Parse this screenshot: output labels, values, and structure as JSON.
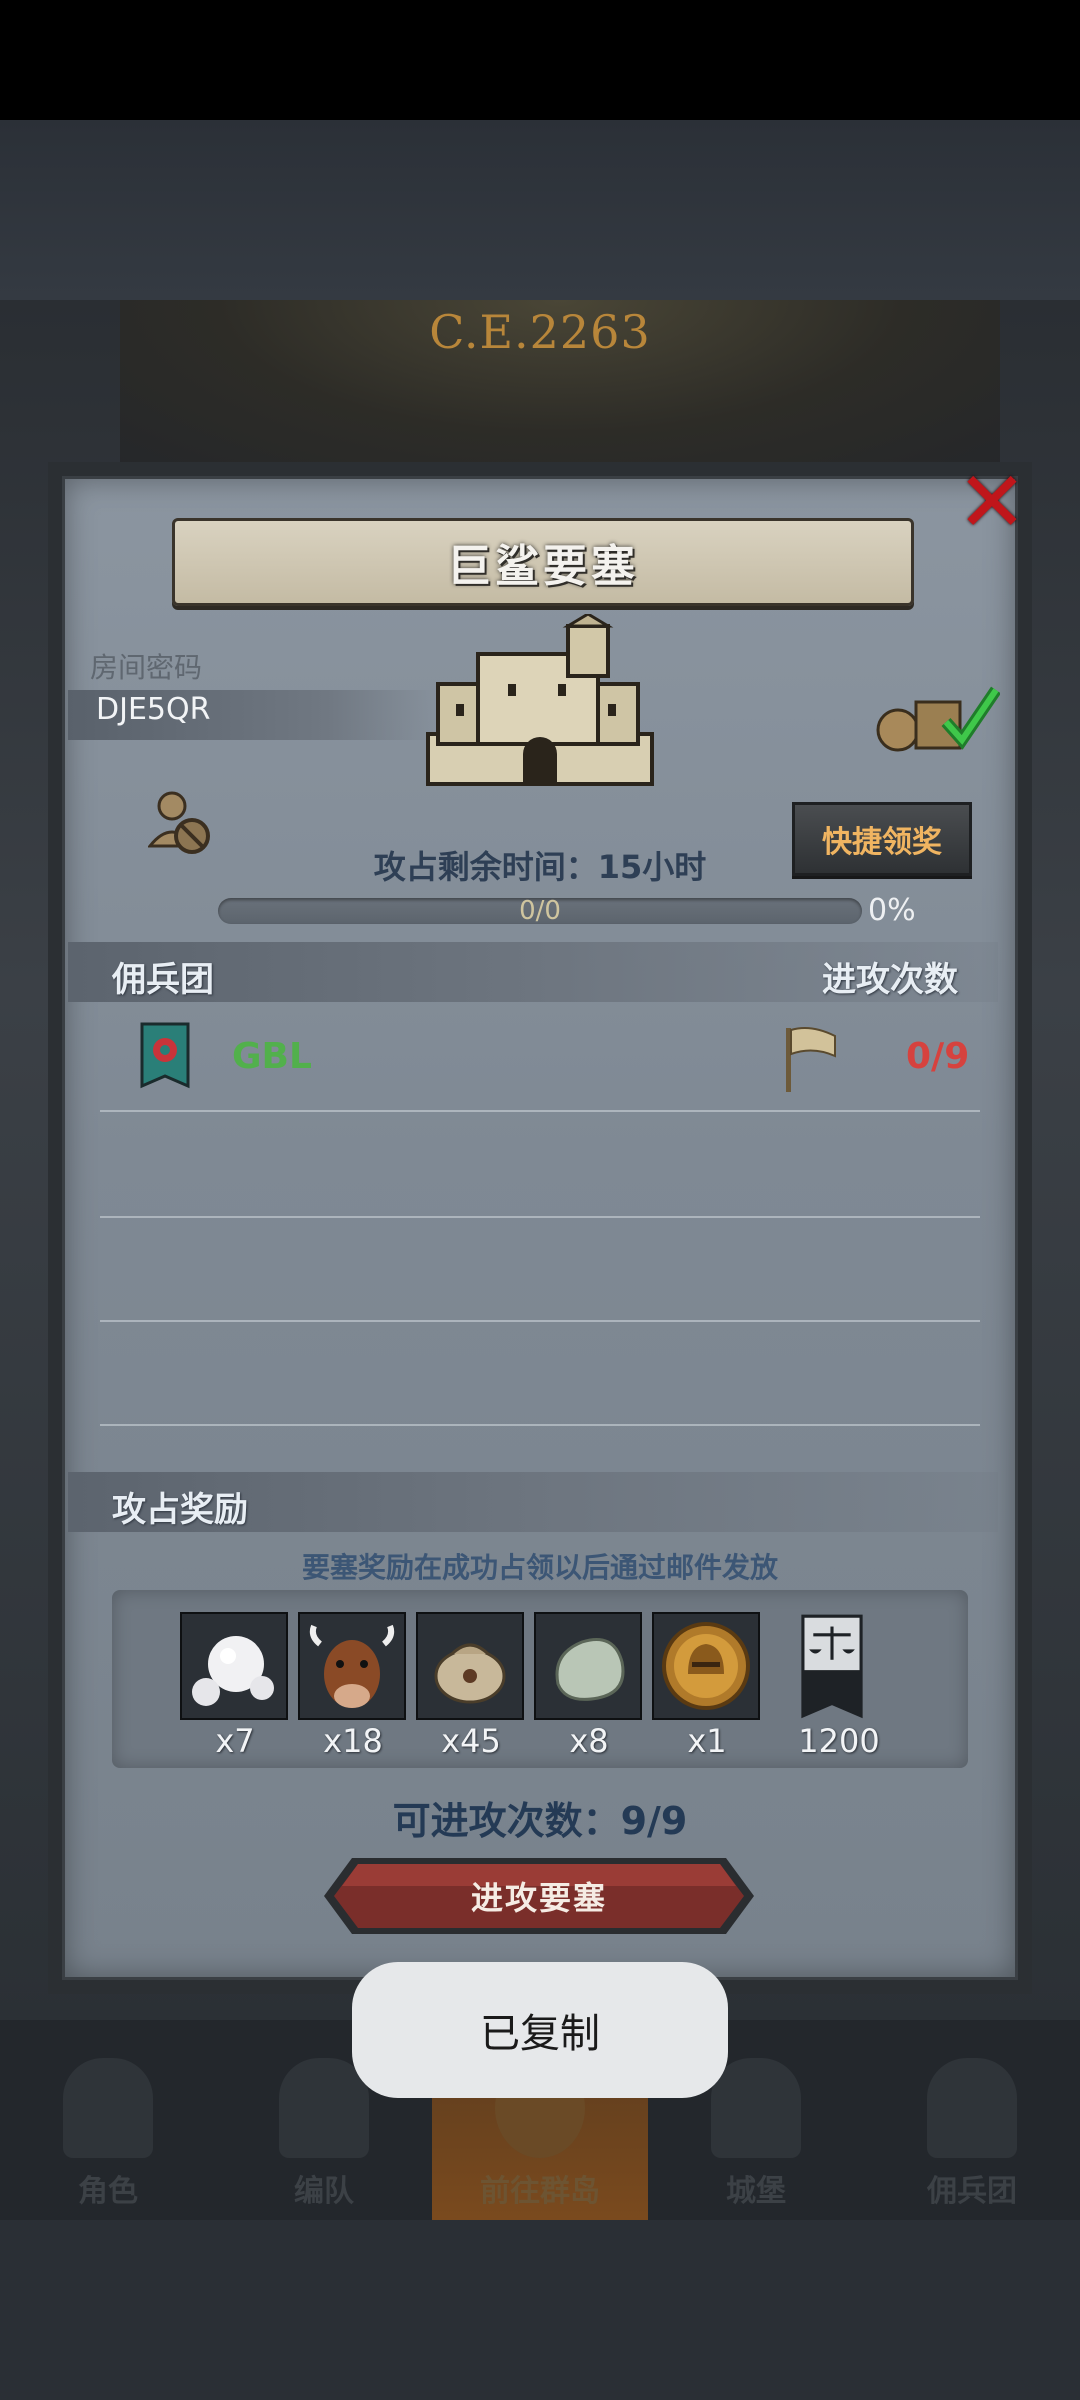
{
  "header": {
    "year": "C.E.2263"
  },
  "dialog": {
    "title": "巨鲨要塞",
    "room_label": "房间密码",
    "room_code": "DJE5QR",
    "quick_claim": "快捷领奖",
    "remaining_time": "攻占剩余时间：15小时",
    "progress": {
      "value": 0,
      "text": "0/0",
      "percent": "0%"
    },
    "guild_header": "佣兵团",
    "attacks_header": "进攻次数",
    "guild": {
      "name": "GBL",
      "attacks": "0/9"
    },
    "reward_header": "攻占奖励",
    "reward_note": "要塞奖励在成功占领以后通过邮件发放",
    "rewards": [
      {
        "icon": "pearl-icon",
        "qty": "x7"
      },
      {
        "icon": "cow-icon",
        "qty": "x18"
      },
      {
        "icon": "sack-icon",
        "qty": "x45"
      },
      {
        "icon": "stone-icon",
        "qty": "x8"
      },
      {
        "icon": "helmet-coin-icon",
        "qty": "x1"
      },
      {
        "icon": "justice-banner-icon",
        "qty": "1200"
      }
    ],
    "attempts": "可进攻次数：9/9",
    "attack_button": "进攻要塞"
  },
  "bottom_nav": [
    {
      "label": "角色",
      "active": false
    },
    {
      "label": "编队",
      "active": false
    },
    {
      "label": "前往群岛",
      "active": true
    },
    {
      "label": "城堡",
      "active": false
    },
    {
      "label": "佣兵团",
      "active": false
    }
  ],
  "toast": "已复制",
  "colors": {
    "guild_name": "#52b04c",
    "attack_count": "#d6423e",
    "close": "#c0161b",
    "accent": "#f0b461"
  }
}
